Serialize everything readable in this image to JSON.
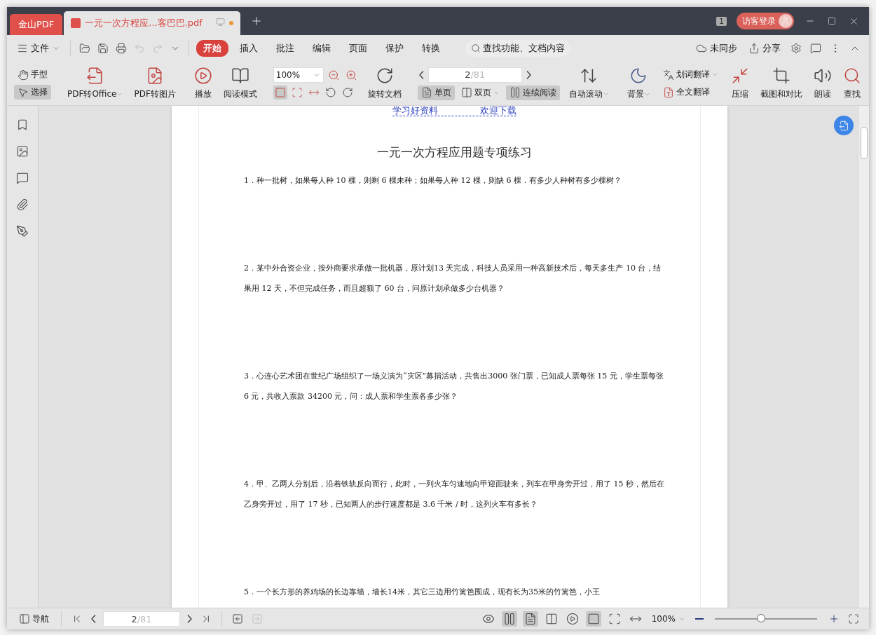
{
  "titlebar": {
    "app_tab": "金山PDF",
    "document_tab": {
      "title": "一元一次方程应...客巴巴.pdf",
      "modified": true
    },
    "badge": "1",
    "login": "访客登录"
  },
  "menu": {
    "file": "文件",
    "items": [
      {
        "label": "开始",
        "selected": true
      },
      {
        "label": "插入",
        "selected": false
      },
      {
        "label": "批注",
        "selected": false
      },
      {
        "label": "编辑",
        "selected": false
      },
      {
        "label": "页面",
        "selected": false
      },
      {
        "label": "保护",
        "selected": false
      },
      {
        "label": "转换",
        "selected": false
      }
    ],
    "search": "查找功能、文档内容",
    "sync": "未同步",
    "share": "分享"
  },
  "toolbar": {
    "tools": [
      {
        "label": "手型",
        "selected": false
      },
      {
        "label": "选择",
        "selected": true
      }
    ],
    "convert": [
      {
        "label": "PDF转Office",
        "dropdown": true
      },
      {
        "label": "PDF转图片",
        "dropdown": false
      }
    ],
    "view": [
      {
        "label": "播放",
        "dropdown": false
      },
      {
        "label": "阅读模式",
        "dropdown": false
      }
    ],
    "zoom": {
      "value": "100%",
      "actual_size_selected": true
    },
    "rotate": {
      "label": "旋转文档",
      "dropdown": false
    },
    "pager": {
      "current": "2",
      "total": "/81"
    },
    "layouts": [
      {
        "label": "单页",
        "selected": true,
        "dropdown": false
      },
      {
        "label": "双页",
        "selected": false,
        "dropdown": true
      },
      {
        "label": "连续阅读",
        "selected": true,
        "dropdown": false
      }
    ],
    "auto_scroll": {
      "label": "自动滚动",
      "dropdown": true
    },
    "background": {
      "label": "背景",
      "dropdown": true
    },
    "translate": [
      {
        "label": "划词翻译",
        "dropdown": true
      },
      {
        "label": "全文翻译",
        "dropdown": false
      }
    ],
    "extras": [
      {
        "label": "压缩",
        "dropdown": false
      },
      {
        "label": "截图和对比",
        "dropdown": false
      },
      {
        "label": "朗读",
        "dropdown": false
      },
      {
        "label": "查找",
        "dropdown": false
      }
    ]
  },
  "document": {
    "header": [
      "学习好资料",
      "欢迎下载"
    ],
    "title": "一元一次方程应用题专项练习",
    "questions": [
      "1．种一批树，如果每人种 10 棵，则剩 6 棵未种；如果每人种 12 棵，则缺 6 棵．有多少人种树有多少棵树？",
      "2．某中外合资企业，按外商要求承做一批机器，原计划13 天完成，科技人员采用一种高新技术后，每天多生产 10 台，结果用 12 天，不但完成任务，而且超额了 60 台，问原计划承做多少台机器？",
      "3．心连心艺术团在世纪广场组织了一场义演为“灾区”募捐活动，共售出3000 张门票，已知成人票每张 15 元，学生票每张 6 元，共收入票款 34200 元，问：成人票和学生票各多少张？",
      "4．甲、乙两人分别后，沿着铁轨反向而行，此时，一列火车匀速地向甲迎面驶来，列车在甲身旁开过，用了 15 秒，然后在乙身旁开过，用了 17 秒，已知两人的步行速度都是 3.6 千米 / 时，这列火车有多长？",
      "5．一个长方形的养鸡场的长边靠墙，墙长14米，其它三边用竹篱笆围成，现有长为35米的竹篱笆，小王"
    ]
  },
  "status_bar": {
    "nav": "导航",
    "pager": {
      "current": "2",
      "total": "/81"
    },
    "view_modes": [
      {
        "selected": false
      },
      {
        "selected": true
      },
      {
        "selected": true
      },
      {
        "selected": false
      },
      {
        "selected": false
      },
      {
        "selected": true
      },
      {
        "selected": false
      },
      {
        "selected": false
      }
    ],
    "zoom": "100%",
    "zoom_slider": {
      "level": 0.46
    }
  }
}
